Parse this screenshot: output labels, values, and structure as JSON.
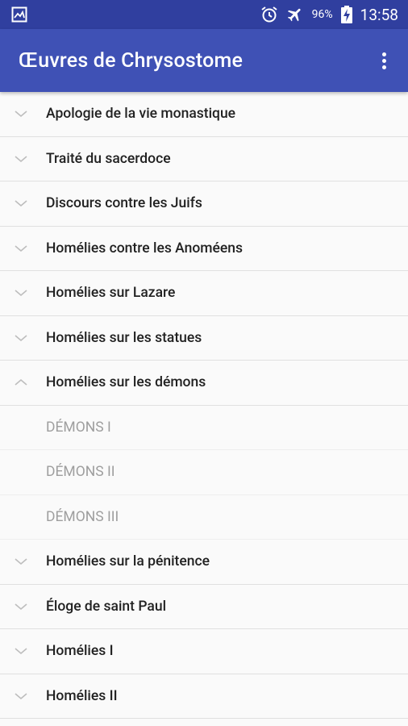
{
  "status_bar": {
    "battery": "96%",
    "time": "13:58"
  },
  "app_bar": {
    "title": "Œuvres de Chrysostome",
    "menu_icon": "overflow-menu-icon"
  },
  "colors": {
    "status_bar": "#303f9f",
    "app_bar": "#3f51b5",
    "text_primary": "#212121",
    "text_child": "#9e9e9e"
  },
  "list": {
    "groups": [
      {
        "label": "Apologie de la vie monastique",
        "expanded": false
      },
      {
        "label": "Traité du sacerdoce",
        "expanded": false
      },
      {
        "label": "Discours contre les Juifs",
        "expanded": false
      },
      {
        "label": "Homélies contre les Anoméens",
        "expanded": false
      },
      {
        "label": "Homélies sur Lazare",
        "expanded": false
      },
      {
        "label": "Homélies sur les statues",
        "expanded": false
      },
      {
        "label": "Homélies sur les démons",
        "expanded": true,
        "children": [
          "DÉMONS I",
          "DÉMONS II",
          "DÉMONS III"
        ]
      },
      {
        "label": "Homélies sur la pénitence",
        "expanded": false
      },
      {
        "label": "Éloge de saint Paul",
        "expanded": false
      },
      {
        "label": "Homélies I",
        "expanded": false
      },
      {
        "label": "Homélies II",
        "expanded": false
      }
    ]
  }
}
